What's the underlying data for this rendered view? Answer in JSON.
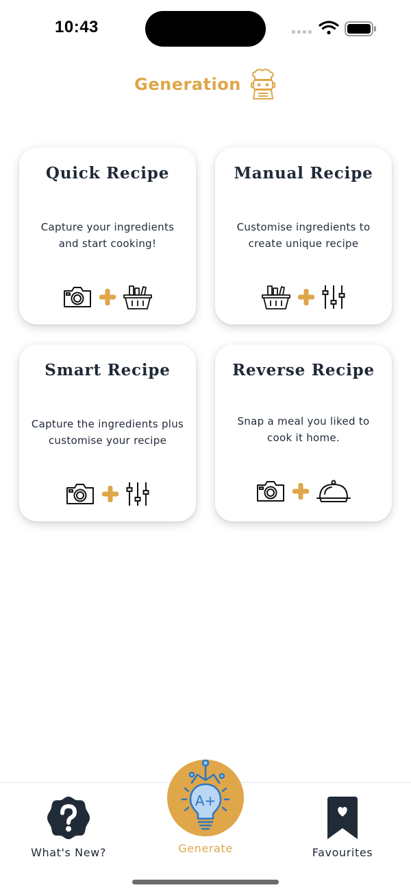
{
  "status_bar": {
    "time": "10:43",
    "icons": [
      "signal-icon",
      "wifi-icon",
      "battery-icon"
    ]
  },
  "header": {
    "title": "Generation",
    "icon": "chef-robot-icon"
  },
  "colors": {
    "accent": "#dfa64a",
    "text": "#1f2937",
    "nav_dark": "#1f2b37",
    "bulb_blue": "#2b78c2"
  },
  "cards": [
    {
      "title": "Quick Recipe",
      "desc_line1": "Capture your ingredients",
      "desc_line2": "and start cooking!",
      "icons": [
        "camera-icon",
        "plus-icon",
        "basket-icon"
      ]
    },
    {
      "title": "Manual Recipe",
      "desc_line1": "Customise ingredients to",
      "desc_line2": "create unique recipe",
      "icons": [
        "basket-icon",
        "plus-icon",
        "sliders-icon"
      ]
    },
    {
      "title": "Smart Recipe",
      "desc_line1": "Capture the ingredients plus",
      "desc_line2": "customise your recipe",
      "icons": [
        "camera-icon",
        "plus-icon",
        "sliders-icon"
      ]
    },
    {
      "title": "Reverse Recipe",
      "desc_line1": "Snap a meal you liked to",
      "desc_line2": "cook it home.",
      "icons": [
        "camera-icon",
        "plus-icon",
        "cloche-icon"
      ]
    }
  ],
  "nav": {
    "whats_new": {
      "label": "What's New?",
      "icon": "question-badge-icon"
    },
    "generate": {
      "label": "Generate",
      "icon": "lightbulb-grade-icon",
      "badge_text": "A+"
    },
    "favourites": {
      "label": "Favourites",
      "icon": "bookmark-heart-icon"
    }
  }
}
